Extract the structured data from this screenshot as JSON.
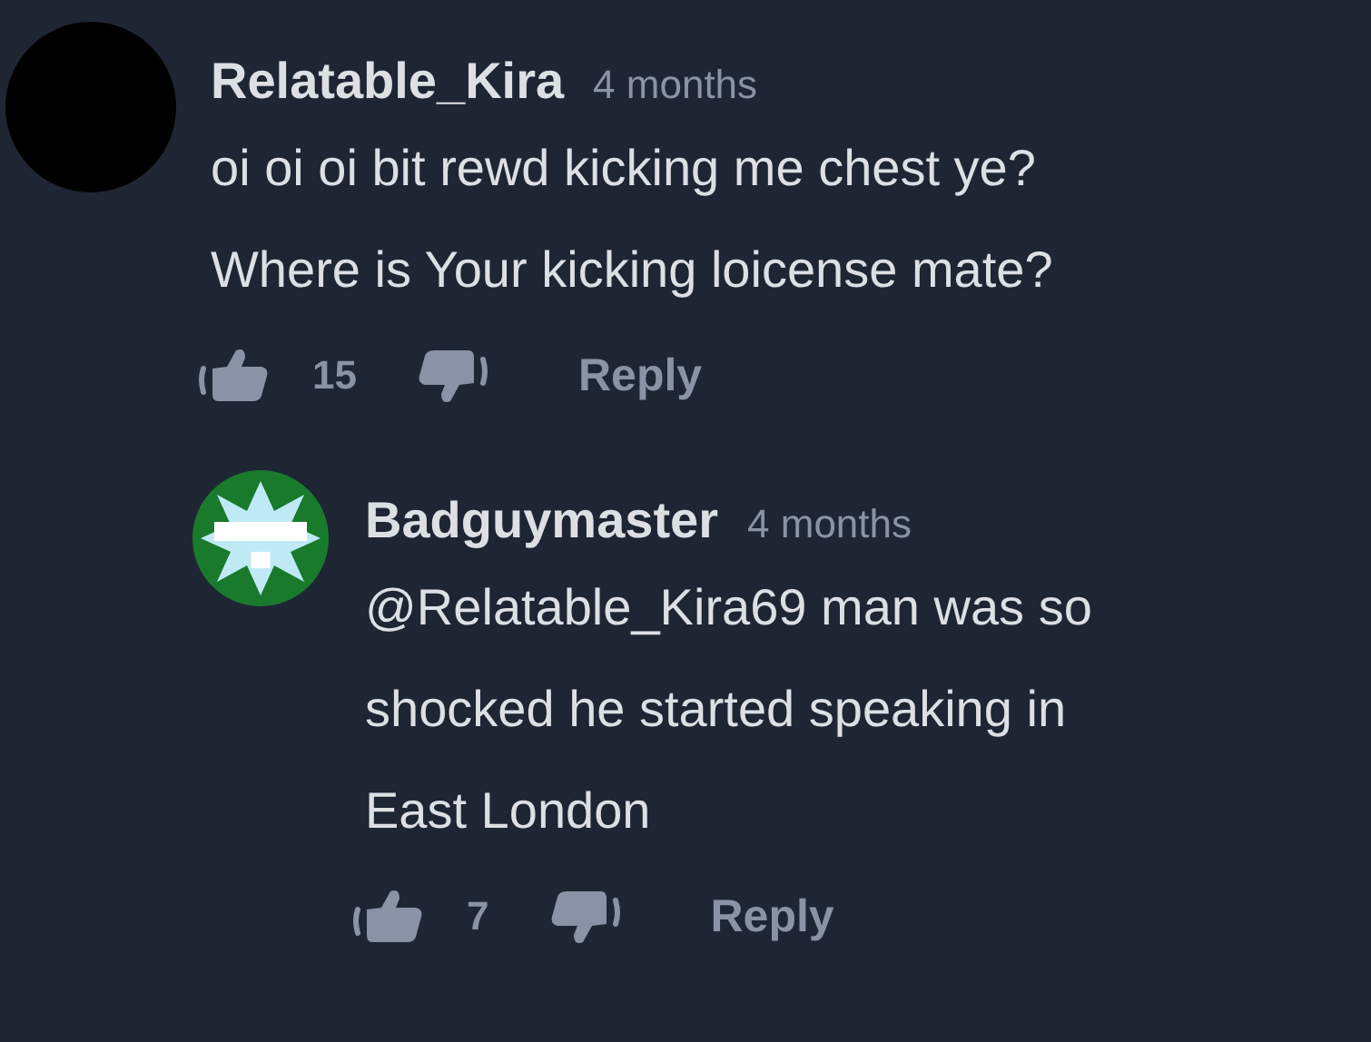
{
  "comments": [
    {
      "author": "Relatable_Kira",
      "time": "4 months",
      "avatar": {
        "kind": "plain"
      },
      "text": "oi oi oi bit rewd kicking me chest ye? Where is Your kicking loicense mate?",
      "likes": "15",
      "reply": "Reply",
      "children": [
        {
          "author": "Badguymaster",
          "time": "4 months",
          "avatar": {
            "kind": "star"
          },
          "text": "@Relatable_Kira69 man was so shocked he started speaking in East London",
          "likes": "7",
          "reply": "Reply"
        }
      ]
    }
  ]
}
